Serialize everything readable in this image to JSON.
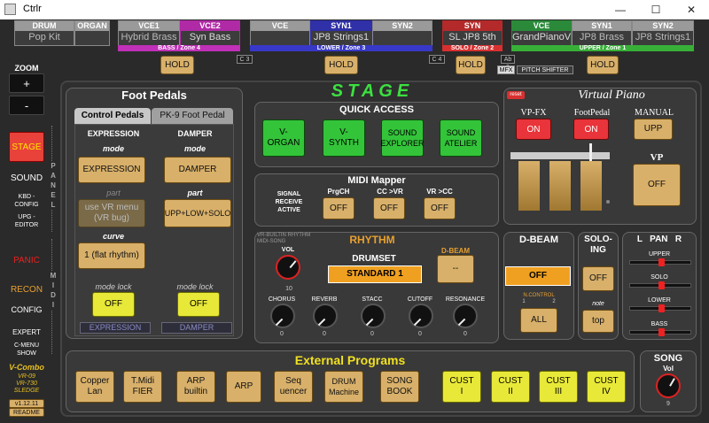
{
  "window": {
    "title": "Ctrlr",
    "min": "—",
    "max": "☐",
    "close": "✕"
  },
  "zones": [
    {
      "name": "DRUM",
      "value": "Pop Kit",
      "color": "#777777"
    },
    {
      "name": "ORGAN",
      "value": "",
      "color": "#777777"
    },
    {
      "name": "VCE1",
      "value": "Hybrid Brass",
      "color": "#777777"
    },
    {
      "name": "VCE2",
      "value": "Syn Bass",
      "color": "#b02aa6"
    },
    {
      "name": "VCE",
      "value": "",
      "color": "#777777"
    },
    {
      "name": "SYN1",
      "value": "JP8 Strings1",
      "color": "#3030a8"
    },
    {
      "name": "SYN2",
      "value": "",
      "color": "#777777"
    },
    {
      "name": "SYN",
      "value": "SL JP8 5th",
      "color": "#b42a2a"
    },
    {
      "name": "VCE",
      "value": "GrandPianoV",
      "color": "#2a8a3a"
    },
    {
      "name": "SYN1",
      "value": "JP8 Brass",
      "color": "#777777"
    },
    {
      "name": "SYN2",
      "value": "JP8 Strings1",
      "color": "#777777"
    }
  ],
  "zone_bars": [
    {
      "label": "BASS / Zone 4",
      "color": "#c030b8"
    },
    {
      "label": "LOWER / Zone 3",
      "color": "#3838c8"
    },
    {
      "label": "SOLO / Zone 2",
      "color": "#d83030"
    },
    {
      "label": "UPPER / Zone 1",
      "color": "#38b038"
    }
  ],
  "hold_label": "HOLD",
  "tags": {
    "c3": "C 3",
    "c4": "C 4",
    "ab3": "Ab 3",
    "mfx": "MFX",
    "pitch": "PITCH SHIFTER"
  },
  "left": {
    "zoom": "ZOOM",
    "plus": "+",
    "minus": "-",
    "stage": "STAGE",
    "sound": "SOUND",
    "kbd": "KBD -\nCONFIG",
    "upg": "UPG -\nEDITOR",
    "panic": "PANIC",
    "recon": "RECON",
    "config": "CONFIG",
    "expert": "EXPERT",
    "cmenu": "C-MENU\nSHOW",
    "logo1": "V-Combo",
    "logo2": "VR-09",
    "logo3": "VR-730",
    "logo4": "SLEDGE",
    "version": "v1.12.11",
    "readme": "README",
    "vpanel": "P\nA\nN\nE\nL",
    "vmidi": "M\nI\nD\nI"
  },
  "stage_title": "STAGE",
  "foot": {
    "title": "Foot Pedals",
    "tab1": "Control Pedals",
    "tab2": "PK-9 Foot Pedal",
    "exp": "EXPRESSION",
    "damp": "DAMPER",
    "mode": "mode",
    "part": "part",
    "curve": "curve",
    "exp_mode": "EXPRESSION",
    "damp_mode": "DAMPER",
    "exp_part": "use VR menu\n(VR bug)",
    "damp_part": "UPP+LOW+SOLO",
    "curve_val": "1 (flat rhythm)",
    "modelock": "mode lock",
    "off": "OFF",
    "exp_foot": "EXPRESSION",
    "damp_foot": "DAMPER"
  },
  "quick": {
    "title": "QUICK ACCESS",
    "b1": "V-\nORGAN",
    "b2": "V-\nSYNTH",
    "b3": "SOUND\nEXPLORER",
    "b4": "SOUND\nATELIER"
  },
  "midi": {
    "title": "MIDI Mapper",
    "signal": "SIGNAL\nRECEIVE\nACTIVE",
    "prgch": "PrgCH",
    "cc_vr": "CC >VR",
    "vr_cc": "VR >CC",
    "off": "OFF"
  },
  "rhythm": {
    "title": "RHYTHM",
    "sub": "VR-BUILTIN RHYTHM\nMIDI-SONG",
    "vol": "VOL",
    "vol_val": "10",
    "drumset": "DRUMSET",
    "drum_val": "STANDARD 1",
    "dbeam": "D-BEAM",
    "dbeam_val": "--",
    "knobs": [
      {
        "label": "CHORUS",
        "value": "0"
      },
      {
        "label": "REVERB",
        "value": "0"
      },
      {
        "label": "STACC",
        "value": "0"
      },
      {
        "label": "CUTOFF",
        "value": "0"
      },
      {
        "label": "RESONANCE",
        "value": "0"
      }
    ]
  },
  "vpiano": {
    "title": "Virtual Piano",
    "reset": "reset",
    "vpfx": "VP-FX",
    "footpedal": "FootPedal",
    "manual": "MANUAL",
    "on": "ON",
    "upp": "UPP",
    "vp": "VP",
    "off": "OFF"
  },
  "dbeam": {
    "title": "D-BEAM",
    "off": "OFF",
    "ncontrol": "N.CONTROL",
    "n1": "1",
    "n2": "2",
    "all": "ALL"
  },
  "soloing": {
    "title": "SOLO-\nING",
    "off": "OFF",
    "note": "note",
    "top": "top"
  },
  "pan": {
    "title": "L   PAN   R",
    "sliders": [
      {
        "label": "UPPER",
        "pos": 0.5
      },
      {
        "label": "SOLO",
        "pos": 0.5
      },
      {
        "label": "LOWER",
        "pos": 0.5
      },
      {
        "label": "BASS",
        "pos": 0.5
      }
    ]
  },
  "ext": {
    "title": "External Programs",
    "buttons": [
      "Copper\nLan",
      "T.Midi\nFIER",
      "ARP\nbuiltin",
      "ARP",
      "Seq\nuencer",
      "DRUM\nMachine",
      "SONG\nBOOK",
      "CUST\nI",
      "CUST\nII",
      "CUST\nIII",
      "CUST\nIV"
    ]
  },
  "song": {
    "title": "SONG",
    "vol": "Vol",
    "vol_val": "9"
  }
}
